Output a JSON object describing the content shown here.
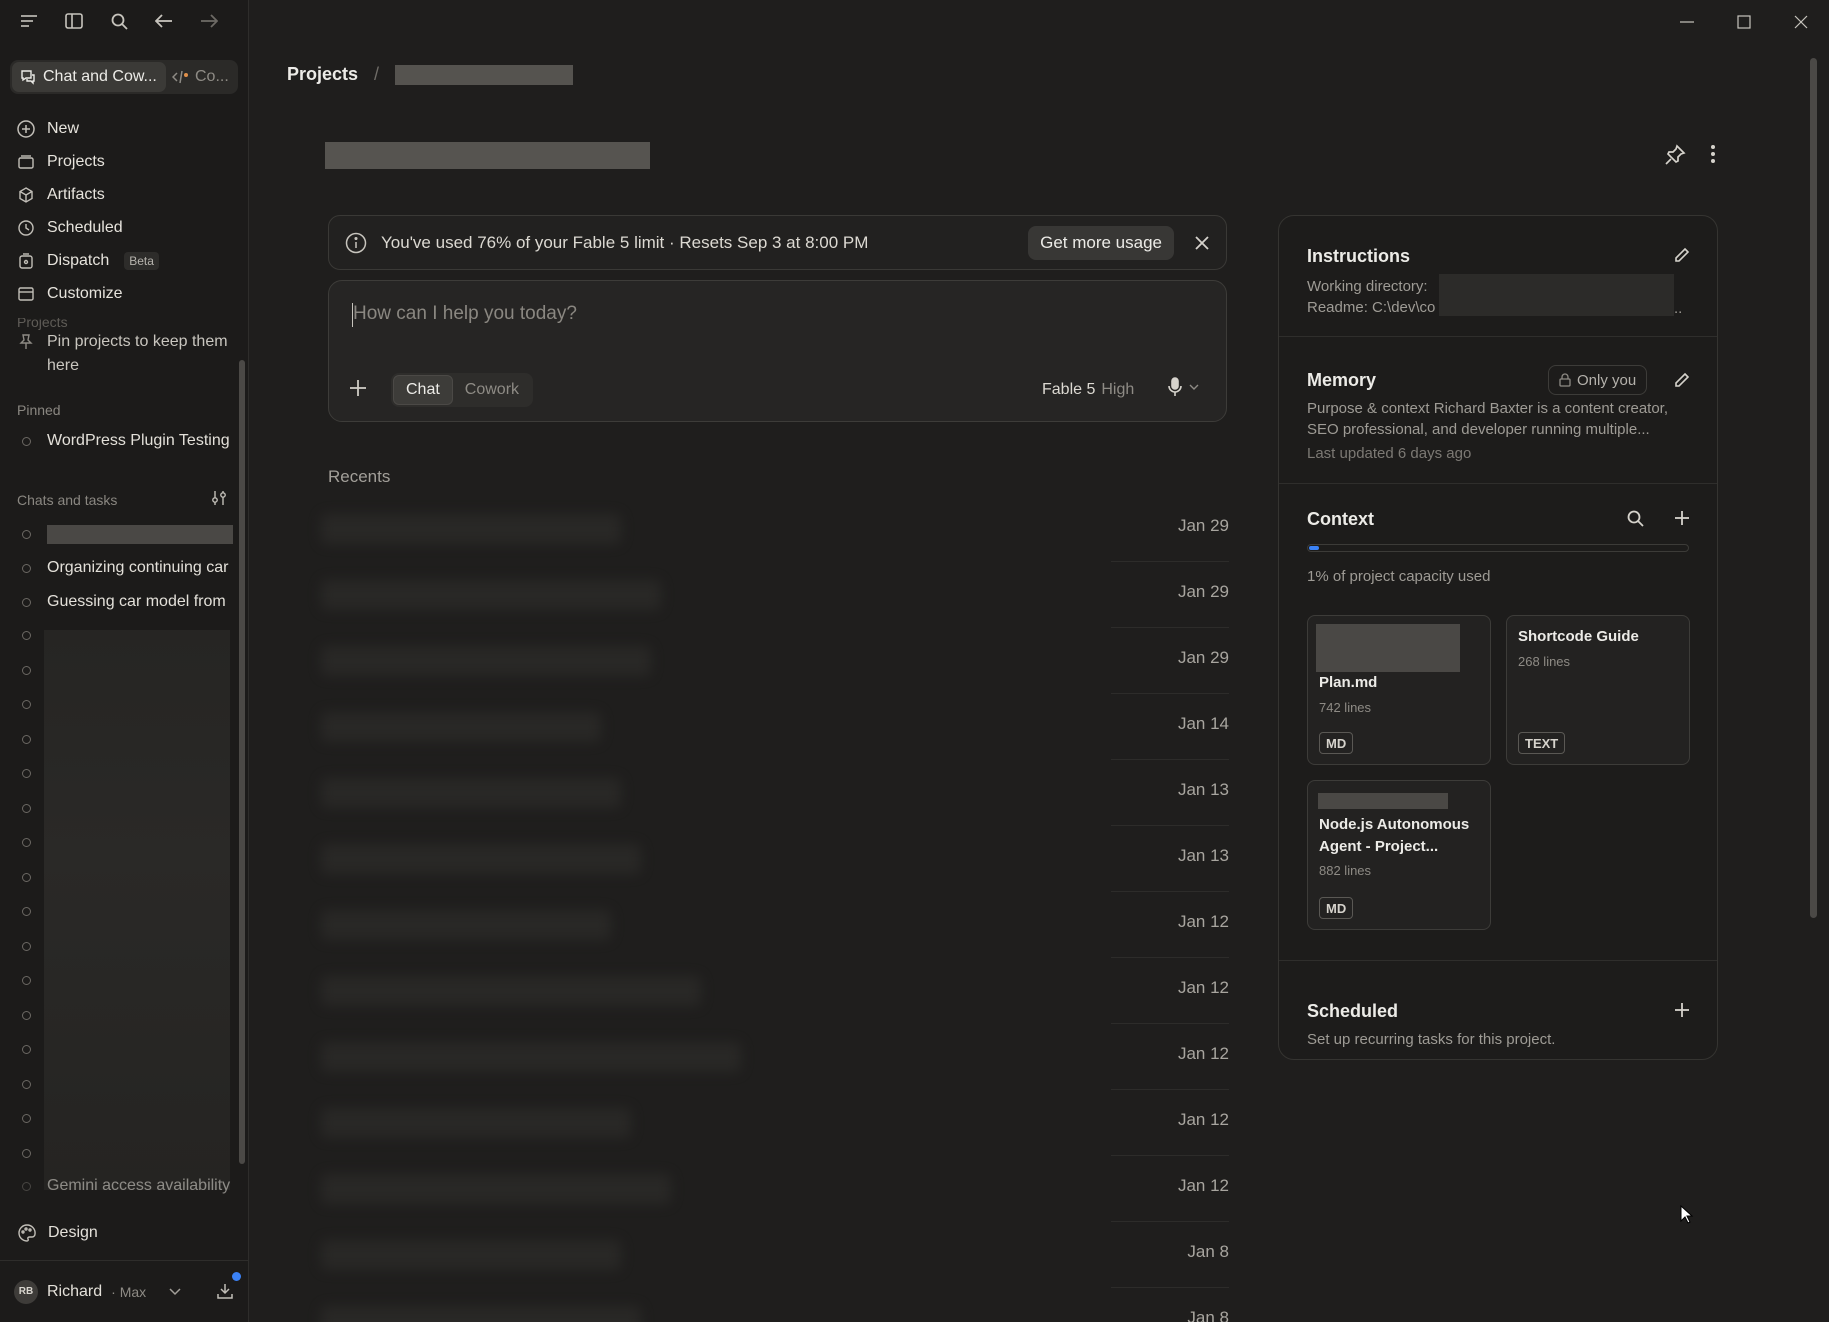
{
  "sidebar": {
    "mode_tabs": {
      "active": "Chat and Cow...",
      "other": "Co..."
    },
    "nav": [
      {
        "label": "New",
        "icon": "plus-icon"
      },
      {
        "label": "Projects",
        "icon": "projects-icon"
      },
      {
        "label": "Artifacts",
        "icon": "artifacts-icon"
      },
      {
        "label": "Scheduled",
        "icon": "clock-icon"
      },
      {
        "label": "Dispatch",
        "icon": "dispatch-icon",
        "badge": "Beta"
      },
      {
        "label": "Customize",
        "icon": "customize-icon"
      }
    ],
    "projects_label": "Projects",
    "pin_hint": "Pin projects to keep them here",
    "pinned_label": "Pinned",
    "pinned_items": [
      "WordPress Plugin Testing"
    ],
    "chats_label": "Chats and tasks",
    "chats": [
      "Organizing continuing car",
      "Guessing car model from",
      "Gemini access availability"
    ],
    "design_label": "Design",
    "user": {
      "initials": "RB",
      "name": "Richard",
      "plan": "· Max"
    }
  },
  "main": {
    "breadcrumb_root": "Projects",
    "breadcrumb_sep": "/",
    "usage": {
      "text": "You've used 76% of your Fable 5 limit · Resets Sep 3 at 8:00 PM",
      "percent_used": 76,
      "button": "Get more usage"
    },
    "composer": {
      "placeholder": "How can I help you today?",
      "mode_chat": "Chat",
      "mode_cowork": "Cowork",
      "model": "Fable 5",
      "effort": "High"
    },
    "recents_label": "Recents",
    "recent_dates": [
      "Jan 29",
      "Jan 29",
      "Jan 29",
      "Jan 14",
      "Jan 13",
      "Jan 13",
      "Jan 12",
      "Jan 12",
      "Jan 12",
      "Jan 12",
      "Jan 12",
      "Jan 8",
      "Jan 8"
    ]
  },
  "panel": {
    "instructions": {
      "title": "Instructions",
      "line1": "Working directory:",
      "line2": "Readme: C:\\dev\\co"
    },
    "memory": {
      "title": "Memory",
      "visibility": "Only you",
      "text": "Purpose & context Richard Baxter is a content creator, SEO professional, and developer running multiple...",
      "updated": "Last updated 6 days ago"
    },
    "context": {
      "title": "Context",
      "capacity_percent": 1,
      "capacity_text": "1% of project capacity used",
      "files": [
        {
          "name": "Plan.md",
          "lines": "742 lines",
          "type": "MD"
        },
        {
          "name": "Shortcode Guide",
          "lines": "268 lines",
          "type": "TEXT"
        },
        {
          "name": "Node.js Autonomous Agent - Project...",
          "lines": "882 lines",
          "type": "MD"
        }
      ]
    },
    "scheduled": {
      "title": "Scheduled",
      "text": "Set up recurring tasks for this project."
    }
  }
}
